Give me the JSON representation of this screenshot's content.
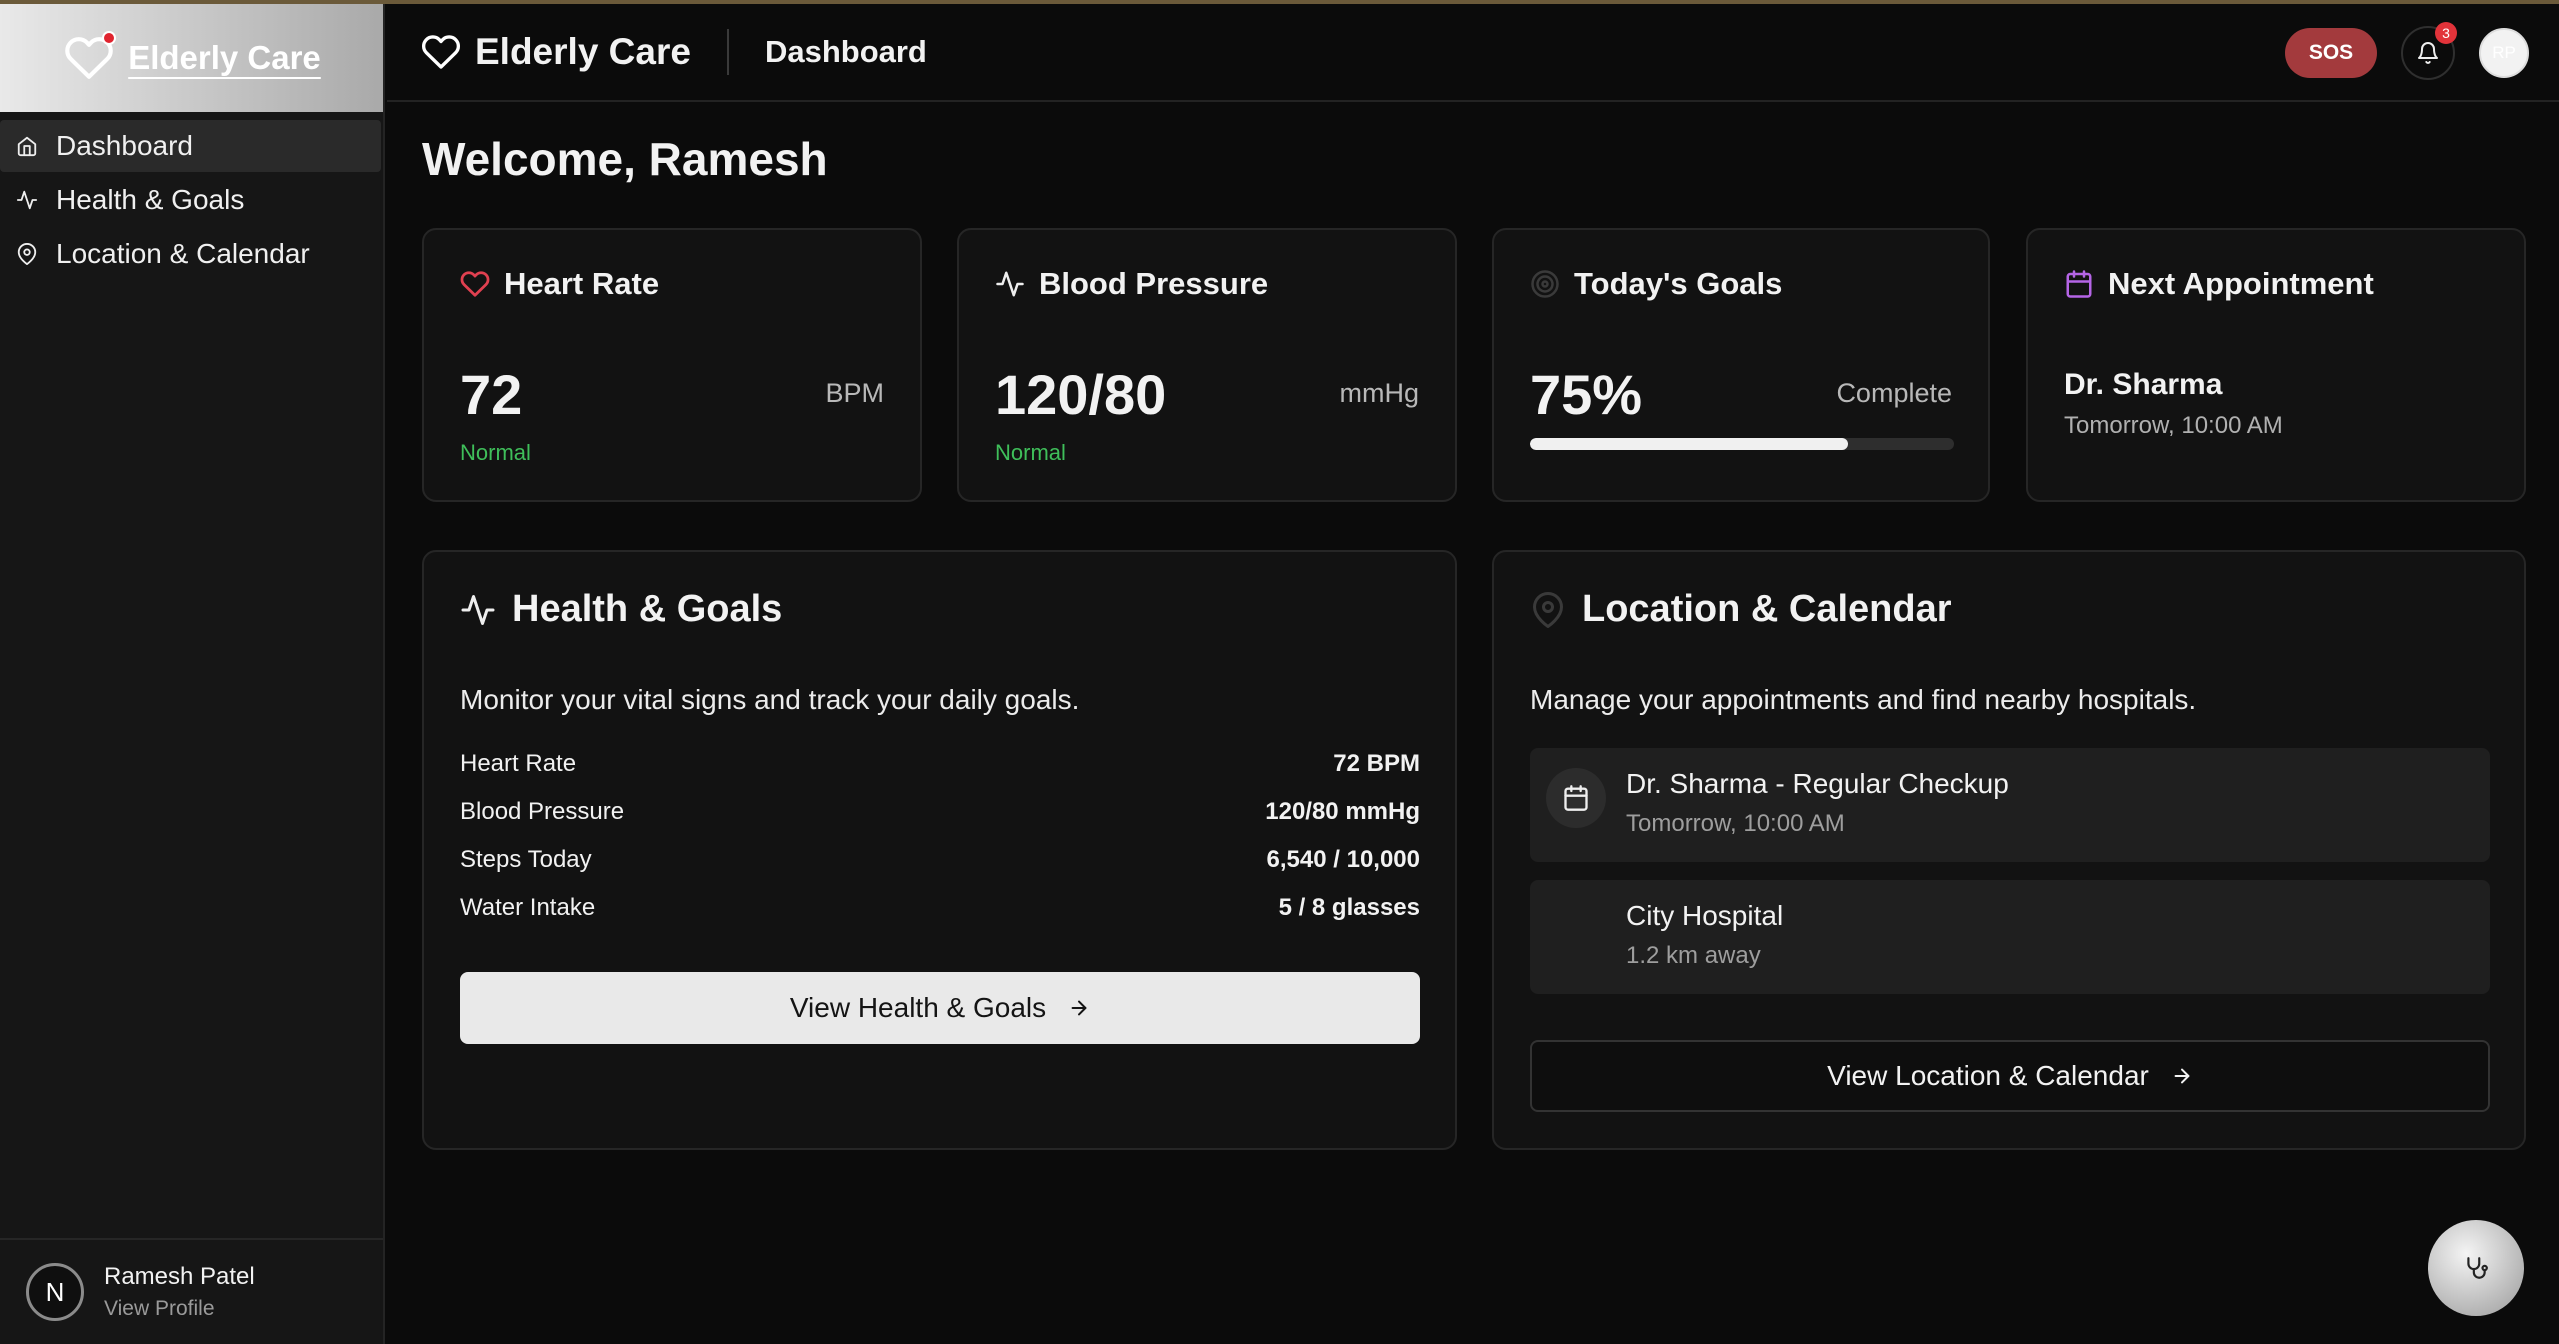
{
  "app": {
    "name": "Elderly Care"
  },
  "sidebar": {
    "items": [
      {
        "label": "Dashboard",
        "icon": "home-icon"
      },
      {
        "label": "Health & Goals",
        "icon": "activity-icon"
      },
      {
        "label": "Location & Calendar",
        "icon": "map-pin-icon"
      }
    ],
    "user": {
      "initial": "N",
      "name": "Ramesh Patel",
      "link": "View Profile"
    }
  },
  "header": {
    "brand": "Elderly Care",
    "page_title": "Dashboard",
    "sos_label": "SOS",
    "notifications_count": "3",
    "avatar_initials": "RP"
  },
  "main": {
    "welcome": "Welcome, Ramesh",
    "stats": {
      "heart_rate": {
        "title": "Heart Rate",
        "value": "72",
        "unit": "BPM",
        "status": "Normal"
      },
      "blood_pressure": {
        "title": "Blood Pressure",
        "value": "120/80",
        "unit": "mmHg",
        "status": "Normal"
      },
      "goals": {
        "title": "Today's Goals",
        "value": "75%",
        "unit": "Complete",
        "progress": 0.75
      },
      "appointment": {
        "title": "Next Appointment",
        "name": "Dr. Sharma",
        "time": "Tomorrow, 10:00 AM"
      }
    },
    "health_card": {
      "title": "Health & Goals",
      "description": "Monitor your vital signs and track your daily goals.",
      "metrics": [
        {
          "label": "Heart Rate",
          "value": "72 BPM"
        },
        {
          "label": "Blood Pressure",
          "value": "120/80 mmHg"
        },
        {
          "label": "Steps Today",
          "value": "6,540 / 10,000"
        },
        {
          "label": "Water Intake",
          "value": "5 / 8 glasses"
        }
      ],
      "button": "View Health & Goals"
    },
    "location_card": {
      "title": "Location & Calendar",
      "description": "Manage your appointments and find nearby hospitals.",
      "items": [
        {
          "title": "Dr. Sharma - Regular Checkup",
          "subtitle": "Tomorrow, 10:00 AM"
        },
        {
          "title": "City Hospital",
          "subtitle": "1.2 km away"
        }
      ],
      "button": "View Location & Calendar"
    }
  },
  "colors": {
    "accent_red": "#e04050",
    "status_green": "#3fbf5a",
    "calendar_purple": "#b565e6",
    "sos": "#a33a3d"
  }
}
